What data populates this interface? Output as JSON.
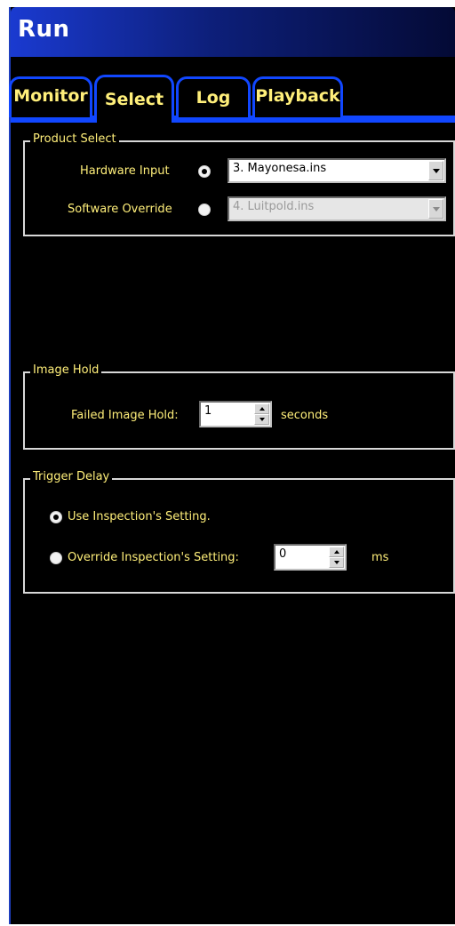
{
  "window": {
    "title": "Run"
  },
  "tabs": [
    {
      "label": "Monitor"
    },
    {
      "label": "Select"
    },
    {
      "label": "Log"
    },
    {
      "label": "Playback"
    }
  ],
  "product_select": {
    "title": "Product Select",
    "hardware_input": {
      "label": "Hardware Input",
      "selected": true,
      "value": "3. Mayonesa.ins"
    },
    "software_override": {
      "label": "Software Override",
      "selected": false,
      "value": "4. Luitpold.ins"
    }
  },
  "image_hold": {
    "title": "Image Hold",
    "failed_label": "Failed Image Hold:",
    "value": "1",
    "unit": "seconds"
  },
  "trigger_delay": {
    "title": "Trigger Delay",
    "use_label": "Use Inspection's Setting.",
    "use_selected": true,
    "override_label": "Override Inspection's Setting:",
    "override_selected": false,
    "override_value": "0",
    "unit": "ms"
  },
  "colors": {
    "accent_blue": "#1147ff",
    "label_yellow": "#ffef7a",
    "background": "#000000"
  }
}
